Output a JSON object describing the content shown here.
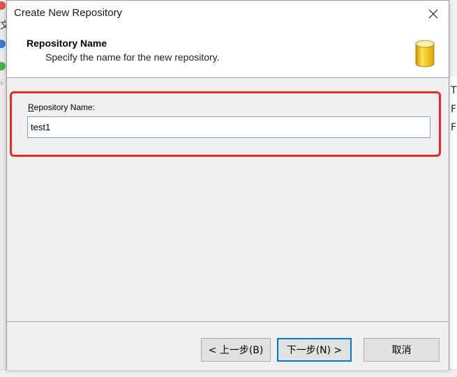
{
  "background": {
    "left_chars": [
      "文",
      "›"
    ],
    "right_chars": [
      "T",
      "F",
      "F"
    ]
  },
  "dialog": {
    "title": "Create New Repository",
    "header": {
      "title": "Repository Name",
      "subtitle": "Specify the name for the new repository."
    },
    "field": {
      "label_mnemonic": "R",
      "label_rest": "epository Name:",
      "value": "test1"
    },
    "buttons": {
      "back": "< 上一步(B)",
      "next": "下一步(N) >",
      "cancel": "取消"
    },
    "icons": {
      "close": "close-icon",
      "repository": "database-icon"
    },
    "colors": {
      "highlight": "#f02525",
      "focus_border": "#0078d7",
      "db_gold": "#f2c200"
    }
  }
}
